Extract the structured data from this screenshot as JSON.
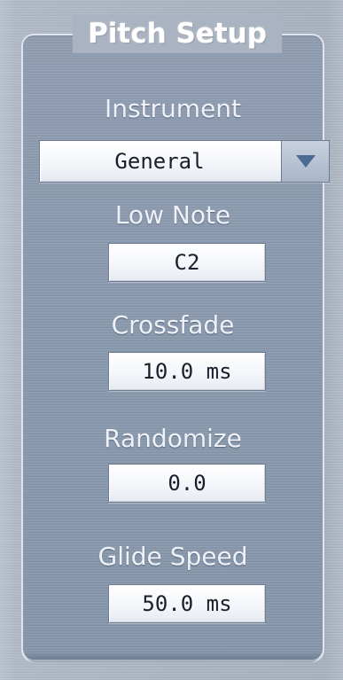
{
  "panel": {
    "title": "Pitch Setup"
  },
  "instrument": {
    "label": "Instrument",
    "selected": "General"
  },
  "low_note": {
    "label": "Low Note",
    "value": "C2"
  },
  "crossfade": {
    "label": "Crossfade",
    "value": "10.0 ms"
  },
  "randomize": {
    "label": "Randomize",
    "value": "0.0"
  },
  "glide_speed": {
    "label": "Glide Speed",
    "value": "50.0 ms"
  },
  "icons": {
    "dropdown": "chevron-down-icon"
  },
  "colors": {
    "label_text": "#eef2f8",
    "field_text": "#1a1f2b",
    "chevron": "#4c6a92"
  }
}
